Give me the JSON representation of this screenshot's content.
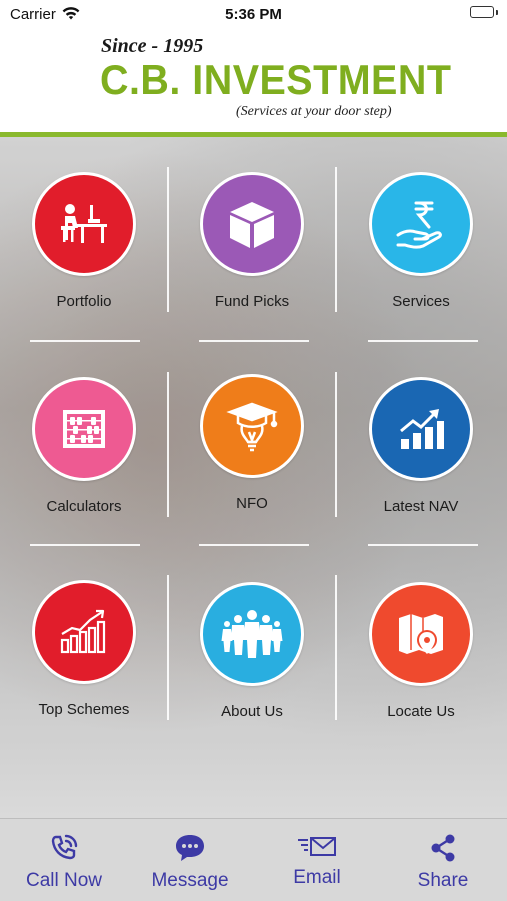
{
  "status_bar": {
    "carrier": "Carrier",
    "time": "5:36 PM"
  },
  "header": {
    "since": "Since - 1995",
    "brand": "C.B. INVESTMENT",
    "tagline": "(Services at your door step)",
    "brand_color": "#7fae1f"
  },
  "tiles": [
    {
      "label": "Portfolio",
      "icon": "desk-worker-icon",
      "color": "#e11d2b"
    },
    {
      "label": "Fund Picks",
      "icon": "box-icon",
      "color": "#9b59b6"
    },
    {
      "label": "Services",
      "icon": "rupee-hand-icon",
      "color": "#29b6e8"
    },
    {
      "label": "Calculators",
      "icon": "abacus-icon",
      "color": "#ee5a92"
    },
    {
      "label": "NFO",
      "icon": "graduation-bulb-icon",
      "color": "#ef7d1a"
    },
    {
      "label": "Latest NAV",
      "icon": "growth-chart-icon",
      "color": "#1a67b3"
    },
    {
      "label": "Top Schemes",
      "icon": "bar-trend-icon",
      "color": "#e11d2b"
    },
    {
      "label": "About Us",
      "icon": "team-icon",
      "color": "#29aee0"
    },
    {
      "label": "Locate Us",
      "icon": "map-pin-icon",
      "color": "#ef4a2e"
    }
  ],
  "bottom_nav": [
    {
      "label": "Call Now",
      "icon": "phone-icon"
    },
    {
      "label": "Message",
      "icon": "chat-bubble-icon"
    },
    {
      "label": "Email",
      "icon": "envelope-icon"
    },
    {
      "label": "Share",
      "icon": "share-icon"
    }
  ],
  "nav_color": "#3d3aa5"
}
